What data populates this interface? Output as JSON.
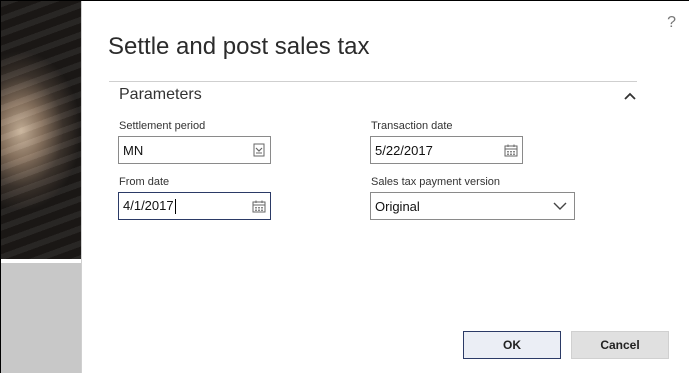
{
  "dialog": {
    "title": "Settle and post sales tax",
    "help_icon": "?"
  },
  "section": {
    "title": "Parameters",
    "collapse_icon": "chevron-up-icon"
  },
  "fields": {
    "settlement_period": {
      "label": "Settlement period",
      "value": "MN",
      "icon": "lookup-icon"
    },
    "from_date": {
      "label": "From date",
      "value": "4/1/2017",
      "icon": "calendar-icon"
    },
    "transaction_date": {
      "label": "Transaction date",
      "value": "5/22/2017",
      "icon": "calendar-icon"
    },
    "sales_tax_payment_version": {
      "label": "Sales tax payment version",
      "value": "Original",
      "icon": "chevron-down-icon"
    }
  },
  "buttons": {
    "ok": "OK",
    "cancel": "Cancel"
  },
  "colors": {
    "accent": "#2b3a66",
    "cancel_bg": "#e0e0e0"
  }
}
